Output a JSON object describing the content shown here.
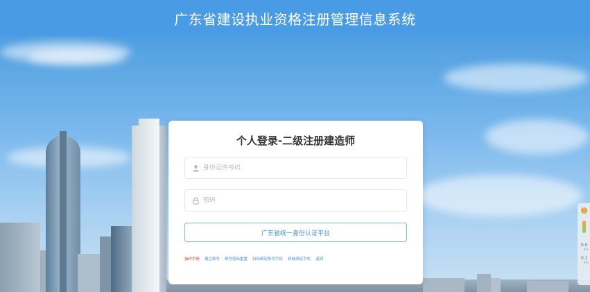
{
  "header": {
    "title": "广东省建设执业资格注册管理信息系统"
  },
  "login": {
    "title": "个人登录-二级注册建造师",
    "id_field": {
      "placeholder": "身份证件号码",
      "icon": "user-icon"
    },
    "password_field": {
      "placeholder": "密码",
      "icon": "lock-icon"
    },
    "auth_button": "广东省统一身份认证平台",
    "links": [
      {
        "label": "操作手册",
        "color": "#e0433a"
      },
      {
        "label": "建立账号",
        "color": "#4a90d6"
      },
      {
        "label": "账号密码重置",
        "color": "#4a90d6"
      },
      {
        "label": "扫码绑定账号手机",
        "color": "#4a90d6"
      },
      {
        "label": "修改绑定手机",
        "color": "#4a90d6"
      },
      {
        "label": "返回",
        "color": "#4a90d6"
      }
    ]
  },
  "side_widget": {
    "badge": "1",
    "values": [
      {
        "value": "0.0",
        "unit": "K/s"
      },
      {
        "value": "0.1",
        "unit": "K/s"
      }
    ]
  },
  "colors": {
    "header_bg": "#4a9be6",
    "accent": "#4a90d6",
    "link_red": "#e0433a"
  }
}
